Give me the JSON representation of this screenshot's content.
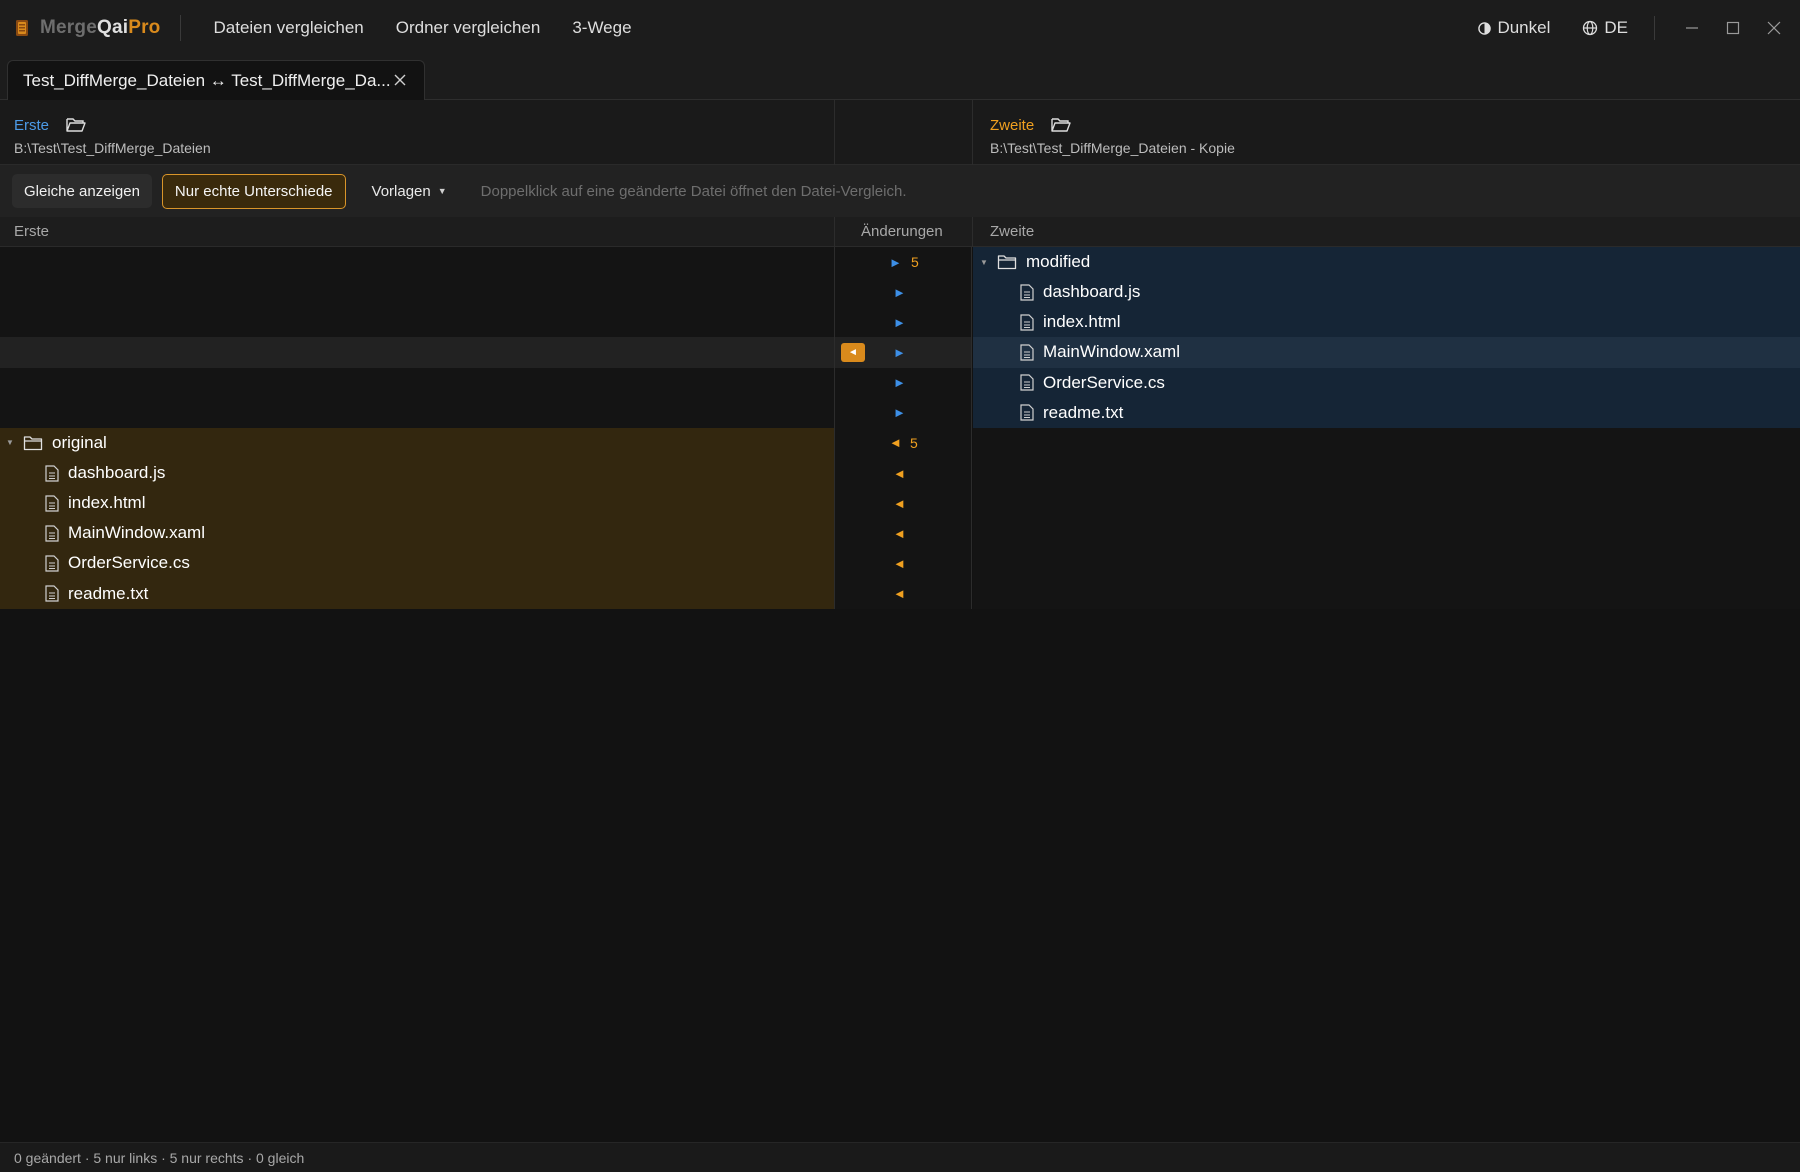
{
  "app": {
    "name_part1": "Merge",
    "name_part2": "Qai",
    "name_part3": "Pro",
    "menu": [
      "Dateien vergleichen",
      "Ordner vergleichen",
      "3-Wege"
    ],
    "theme_label": "Dunkel",
    "language_label": "DE",
    "accent_color": "#d98a1c"
  },
  "tab": {
    "label": "Test_DiffMerge_Dateien ↔ Test_DiffMerge_Da..."
  },
  "paths": {
    "left_label": "Erste",
    "left_path": "B:\\Test\\Test_DiffMerge_Dateien",
    "right_label": "Zweite",
    "right_path": "B:\\Test\\Test_DiffMerge_Dateien - Kopie"
  },
  "toolbar": {
    "show_equal": "Gleiche anzeigen",
    "only_real_diffs": "Nur echte Unterschiede",
    "templates": "Vorlagen",
    "hint": "Doppelklick auf eine geänderte Datei öffnet den Datei-Vergleich."
  },
  "columns": {
    "left": "Erste",
    "changes": "Änderungen",
    "right": "Zweite"
  },
  "rows": {
    "right_folder": {
      "name": "modified",
      "count": "5"
    },
    "right_files": [
      "dashboard.js",
      "index.html",
      "MainWindow.xaml",
      "OrderService.cs",
      "readme.txt"
    ],
    "left_folder": {
      "name": "original",
      "count": "5"
    },
    "left_files": [
      "dashboard.js",
      "index.html",
      "MainWindow.xaml",
      "OrderService.cs",
      "readme.txt"
    ],
    "arrow_right": "►",
    "arrow_left": "◄",
    "copy_left_glyph": "◄"
  },
  "status": {
    "text": "0 geändert · 5 nur links · 5 nur rechts · 0 gleich"
  }
}
